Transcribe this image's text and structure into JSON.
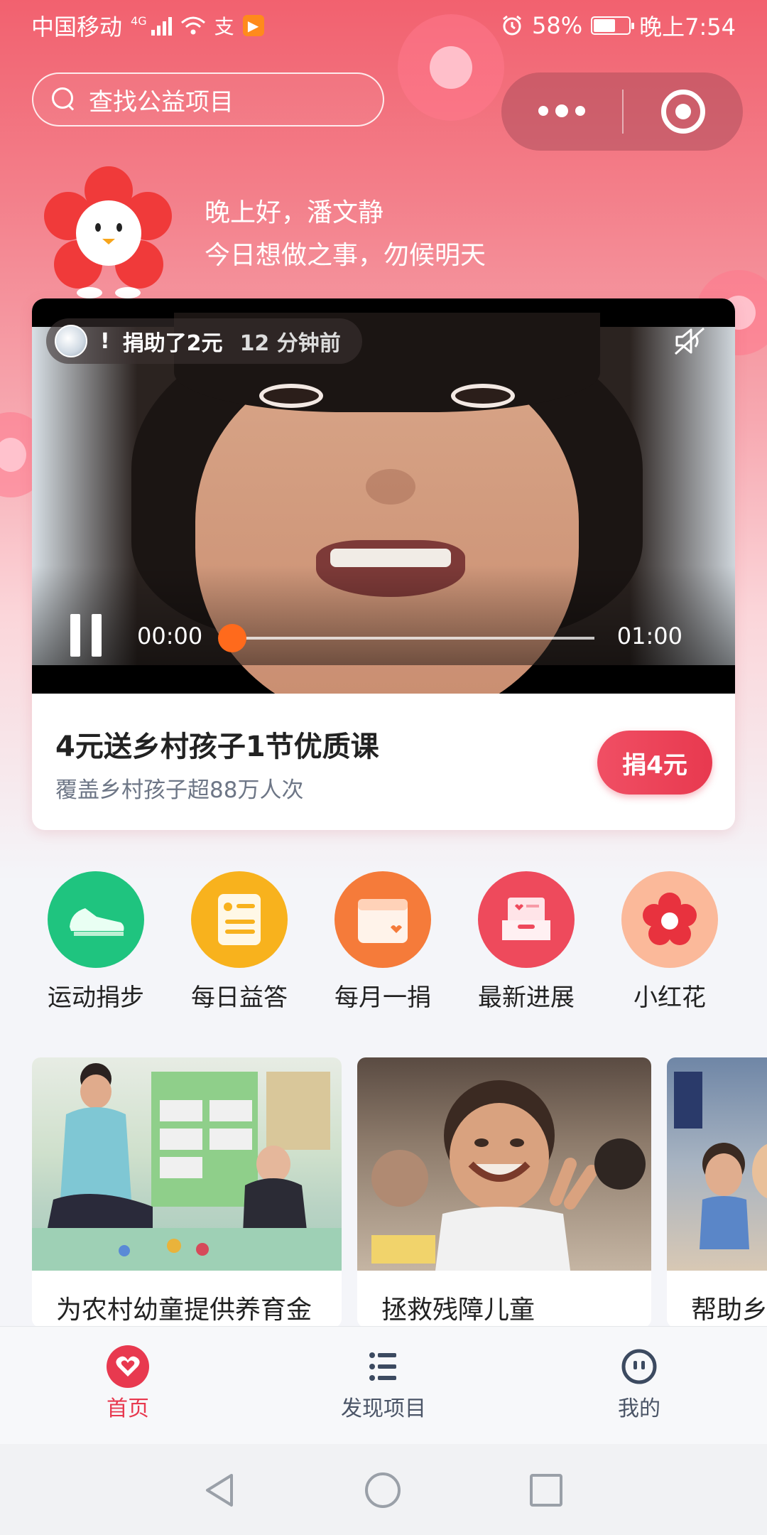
{
  "status_bar": {
    "carrier": "中国移动",
    "network": "4G",
    "battery": "58%",
    "time": "晚上7:54"
  },
  "search": {
    "placeholder": "查找公益项目"
  },
  "greeting": {
    "line1": "晚上好，潘文静",
    "line2": "今日想做之事，勿候明天"
  },
  "video": {
    "donation_action": "捐助了2元",
    "donation_time": "12 分钟前",
    "current_time": "00:00",
    "duration": "01:00",
    "progress": 0
  },
  "featured": {
    "title": "4元送乡村孩子1节优质课",
    "subtitle": "覆盖乡村孩子超88万人次",
    "donate_label": "捐4元"
  },
  "quick_entries": [
    {
      "label": "运动捐步",
      "icon": "sneaker-icon",
      "color": "#1fc47f"
    },
    {
      "label": "每日益答",
      "icon": "quiz-card-icon",
      "color": "#f8b21d"
    },
    {
      "label": "每月一捐",
      "icon": "calendar-heart-icon",
      "color": "#f57b3a"
    },
    {
      "label": "最新进展",
      "icon": "inbox-heart-icon",
      "color": "#ee4a5c"
    },
    {
      "label": "小红花",
      "icon": "red-flower-icon",
      "color": "#fbb99a"
    }
  ],
  "projects": [
    {
      "title": "为农村幼童提供养育金"
    },
    {
      "title": "拯救残障儿童"
    },
    {
      "title": "帮助乡"
    }
  ],
  "tabbar": {
    "tabs": [
      {
        "label": "首页",
        "icon": "heart-home-icon",
        "active": true
      },
      {
        "label": "发现项目",
        "icon": "list-icon",
        "active": false
      },
      {
        "label": "我的",
        "icon": "face-icon",
        "active": false
      }
    ],
    "accent": "#e8394f"
  }
}
